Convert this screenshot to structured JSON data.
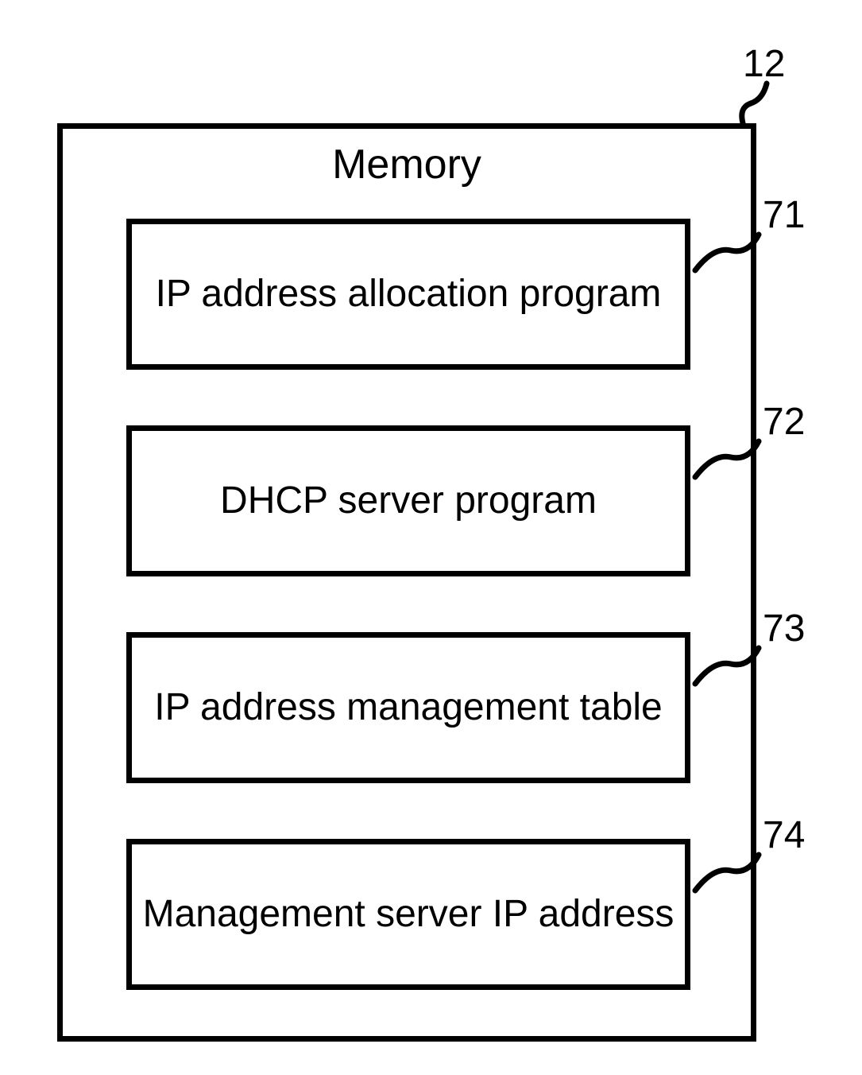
{
  "container": {
    "title": "Memory",
    "ref": "12"
  },
  "items": [
    {
      "label": "IP address allocation program",
      "ref": "71"
    },
    {
      "label": "DHCP server program",
      "ref": "72"
    },
    {
      "label": "IP address management table",
      "ref": "73"
    },
    {
      "label": "Management server IP address",
      "ref": "74"
    }
  ]
}
